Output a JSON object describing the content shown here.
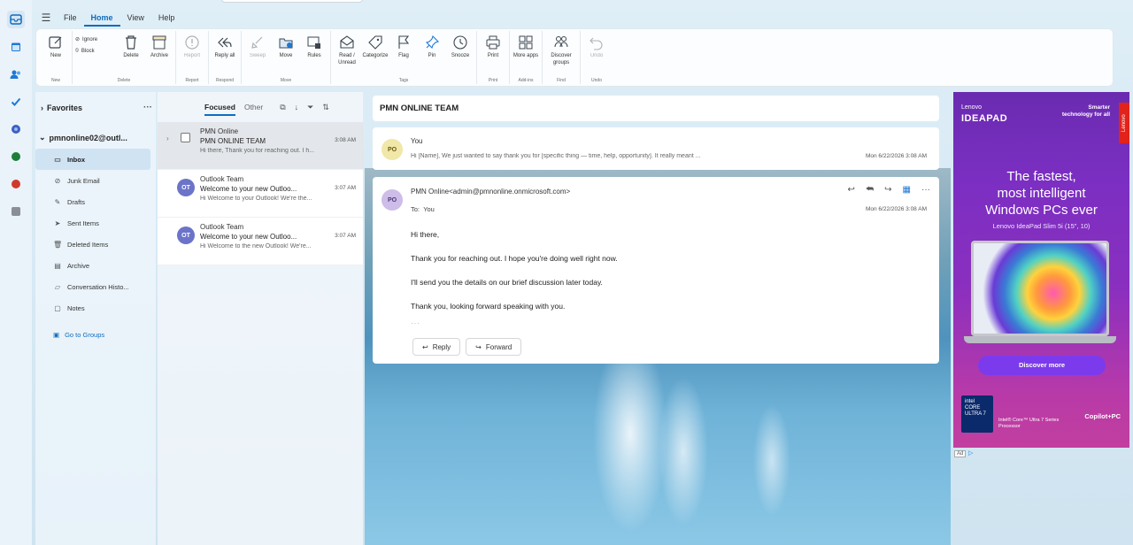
{
  "menu": {
    "tabs": [
      "File",
      "Home",
      "View",
      "Help"
    ],
    "active_tab": "Home"
  },
  "ribbon": {
    "groups": [
      {
        "label": "New",
        "buttons": [
          {
            "label": "New",
            "icon": "compose-icon"
          }
        ]
      },
      {
        "label": "Delete",
        "small": [
          {
            "label": "Ignore"
          },
          {
            "label": "Block"
          }
        ],
        "buttons": [
          {
            "label": "Delete",
            "icon": "trash-icon"
          },
          {
            "label": "Archive",
            "icon": "archive-icon"
          }
        ]
      },
      {
        "label": "Report",
        "buttons": [
          {
            "label": "Report",
            "icon": "report-icon"
          }
        ]
      },
      {
        "label": "Respond",
        "buttons": [
          {
            "label": "Reply all",
            "icon": "reply-all-icon"
          }
        ]
      },
      {
        "label": "Move",
        "buttons": [
          {
            "label": "Sweep",
            "icon": "sweep-icon"
          },
          {
            "label": "Move",
            "icon": "move-icon"
          },
          {
            "label": "Rules",
            "icon": "rules-icon"
          }
        ]
      },
      {
        "label": "Tags",
        "buttons": [
          {
            "label": "Read / Unread",
            "icon": "envelope-icon"
          },
          {
            "label": "Categorize",
            "icon": "tag-icon"
          },
          {
            "label": "Flag",
            "icon": "flag-icon"
          },
          {
            "label": "Pin",
            "icon": "pin-icon"
          },
          {
            "label": "Snooze",
            "icon": "clock-icon"
          }
        ]
      },
      {
        "label": "Print",
        "buttons": [
          {
            "label": "Print",
            "icon": "printer-icon"
          }
        ]
      },
      {
        "label": "Add-ins",
        "buttons": [
          {
            "label": "More apps",
            "icon": "apps-icon"
          }
        ]
      },
      {
        "label": "Find",
        "buttons": [
          {
            "label": "Discover groups",
            "icon": "groups-icon"
          }
        ]
      },
      {
        "label": "Undo",
        "buttons": [
          {
            "label": "Undo",
            "icon": "undo-icon"
          }
        ]
      }
    ]
  },
  "folders": {
    "favorites_label": "Favorites",
    "account": "pmnonline02@outl...",
    "items": [
      {
        "label": "Inbox",
        "icon": "inbox-icon",
        "active": true
      },
      {
        "label": "Junk Email",
        "icon": "junk-icon"
      },
      {
        "label": "Drafts",
        "icon": "pencil-icon"
      },
      {
        "label": "Sent Items",
        "icon": "send-icon"
      },
      {
        "label": "Deleted Items",
        "icon": "trash-icon"
      },
      {
        "label": "Archive",
        "icon": "archive-icon"
      },
      {
        "label": "Conversation Histo...",
        "icon": "folder-icon"
      },
      {
        "label": "Notes",
        "icon": "note-icon"
      }
    ],
    "groups_link": "Go to Groups"
  },
  "list": {
    "tab_focused": "Focused",
    "tab_other": "Other",
    "messages": [
      {
        "sender": "PMN Online",
        "subject": "PMN ONLINE TEAM",
        "time": "3:08 AM",
        "preview": "Hi there, Thank you for reaching out. I h..."
      },
      {
        "initials": "OT",
        "sender": "Outlook Team",
        "subject": "Welcome to your new Outloo...",
        "time": "3:07 AM",
        "preview": "Hi Welcome to your Outlook! We're the..."
      },
      {
        "initials": "OT",
        "sender": "Outlook Team",
        "subject": "Welcome to your new Outloo...",
        "time": "3:07 AM",
        "preview": "Hi Welcome to the new Outlook! We're..."
      }
    ]
  },
  "reading": {
    "subject": "PMN ONLINE TEAM",
    "collapsed": {
      "initials": "PO",
      "from": "You",
      "snippet": "Hi [Name], We just wanted to say thank you for [specific thing — time, help, opportunity]. It really meant ...",
      "date": "Mon 6/22/2026 3:08 AM"
    },
    "open": {
      "initials": "PO",
      "from": "PMN Online<admin@pmnonline.onmicrosoft.com>",
      "to_label": "To:",
      "to": "You",
      "date": "Mon 6/22/2026 3:08 AM",
      "body": [
        "Hi there,",
        "Thank you for reaching out. I hope you're doing well right now.",
        "I'll send you the details on our brief discussion later today.",
        "Thank you, looking forward speaking with you."
      ],
      "reply_label": "Reply",
      "forward_label": "Forward"
    }
  },
  "ad": {
    "brand": "Lenovo",
    "product_line": "IDEAPAD",
    "tagline": "Smarter technology for all",
    "side_tab": "Lenovo",
    "headline_1": "The fastest,",
    "headline_2": "most intelligent",
    "headline_3": "Windows PCs ever",
    "model": "Lenovo IdeaPad Slim 5i (15\", 10)",
    "cta": "Discover more",
    "intel_badge": "intel CORE ULTRA 7",
    "intel_text": "Intel® Core™ Ultra 7 Series Processor",
    "copilot": "Copilot+PC",
    "ad_marker": "Ad",
    "colors": {
      "primary": "#7b2fc2",
      "accent": "#c23f9f",
      "cta": "#7c3aed"
    }
  },
  "colors": {
    "accent": "#0f6cbd"
  }
}
